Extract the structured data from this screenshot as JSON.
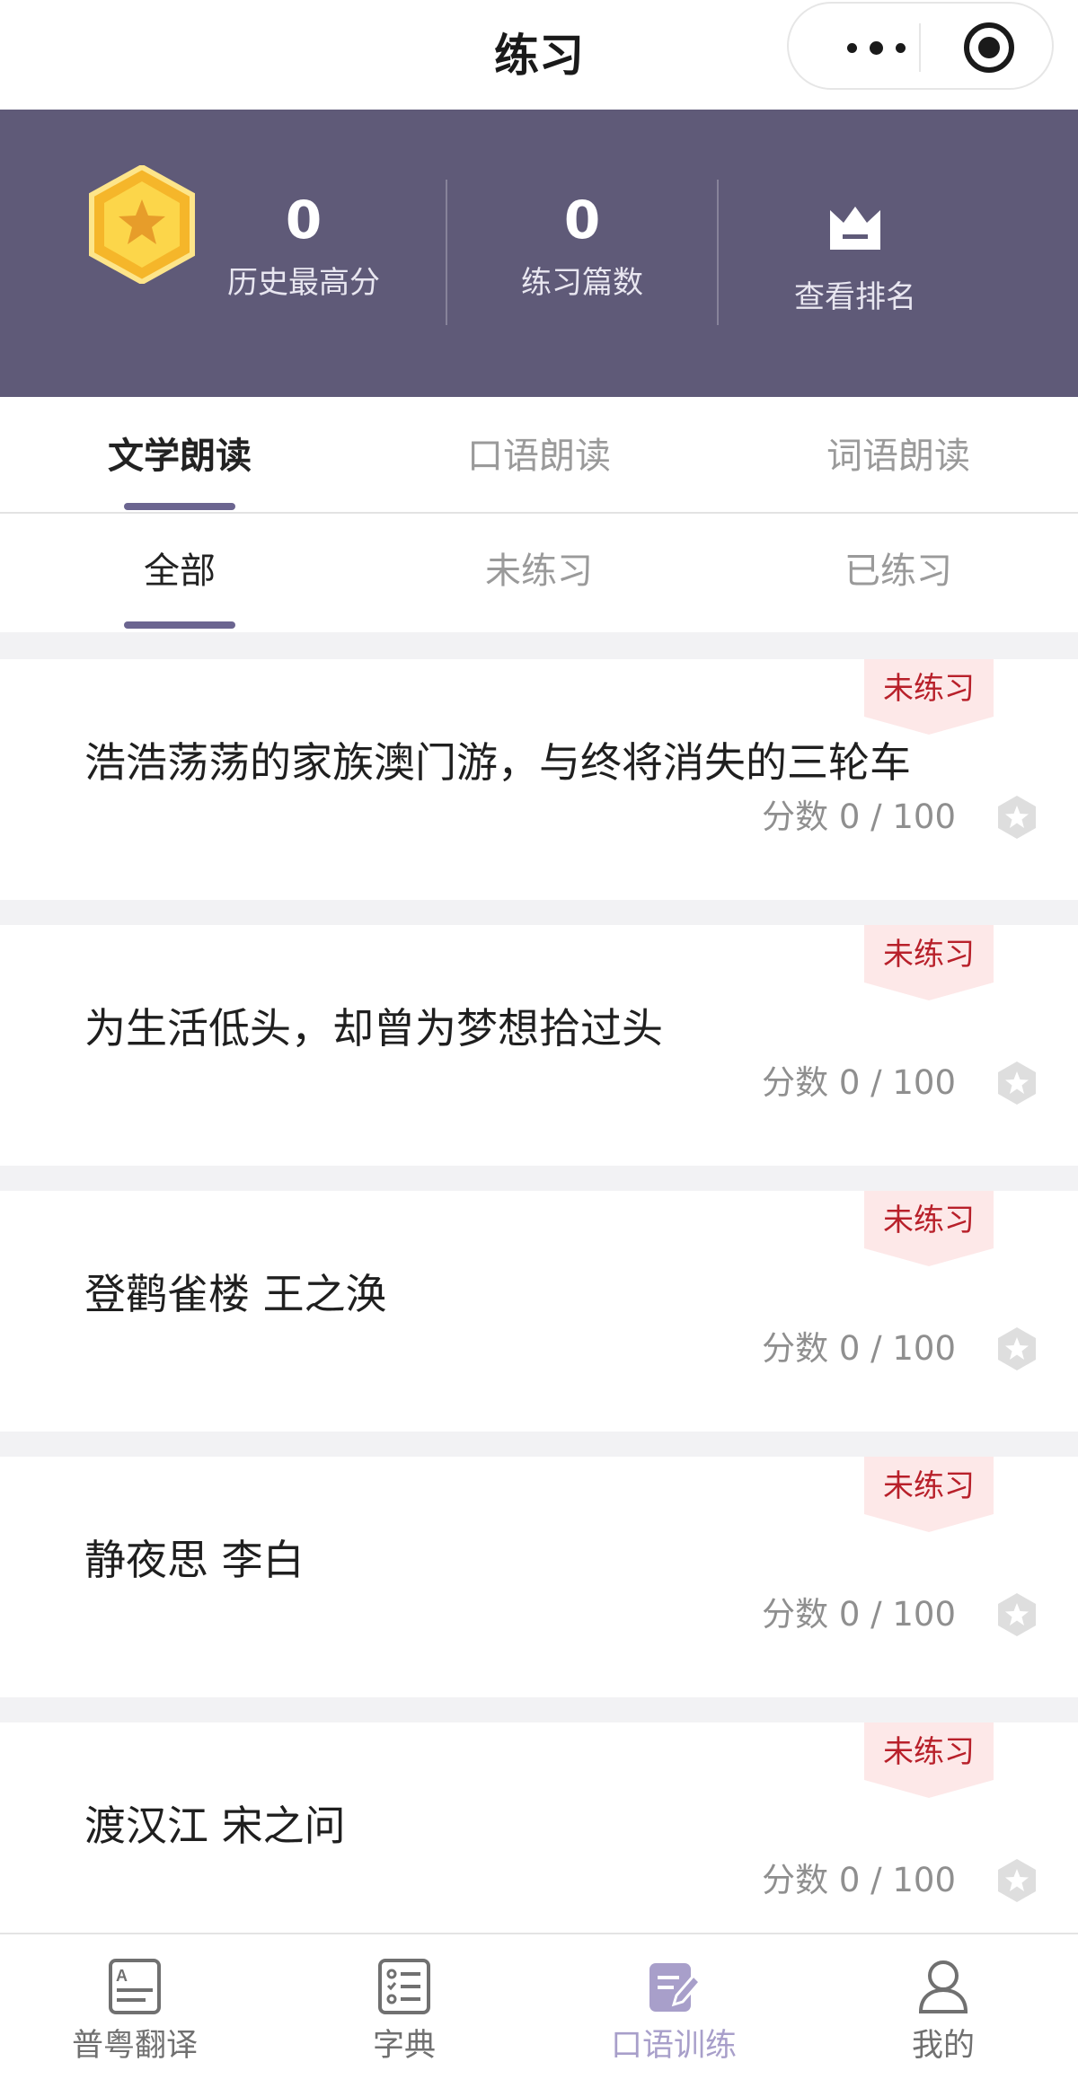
{
  "titlebar": {
    "title": "练习"
  },
  "stats": {
    "best_score": {
      "value": "0",
      "label": "历史最高分"
    },
    "practice_count": {
      "value": "0",
      "label": "练习篇数"
    },
    "ranking": {
      "label": "查看排名"
    }
  },
  "primary_tabs": [
    {
      "label": "文学朗读",
      "active": true
    },
    {
      "label": "口语朗读",
      "active": false
    },
    {
      "label": "词语朗读",
      "active": false
    }
  ],
  "filter_tabs": [
    {
      "label": "全部",
      "active": true
    },
    {
      "label": "未练习",
      "active": false
    },
    {
      "label": "已练习",
      "active": false
    }
  ],
  "items": [
    {
      "title": "浩浩荡荡的家族澳门游，与终将消失的三轮车",
      "status": "未练习",
      "score": "分数 0 / 100"
    },
    {
      "title": "为生活低头，却曾为梦想拾过头",
      "status": "未练习",
      "score": "分数 0 / 100"
    },
    {
      "title": "登鹳雀楼 王之涣",
      "status": "未练习",
      "score": "分数 0 / 100"
    },
    {
      "title": "静夜思 李白",
      "status": "未练习",
      "score": "分数 0 / 100"
    },
    {
      "title": "渡汉江 宋之问",
      "status": "未练习",
      "score": "分数 0 / 100"
    }
  ],
  "bottom_nav": [
    {
      "label": "普粤翻译",
      "icon": "translate-card-icon",
      "active": false
    },
    {
      "label": "字典",
      "icon": "checklist-icon",
      "active": false
    },
    {
      "label": "口语训练",
      "icon": "edit-note-icon",
      "active": true
    },
    {
      "label": "我的",
      "icon": "user-icon",
      "active": false
    }
  ],
  "colors": {
    "banner": "#5f5a78",
    "accent": "#6b6590",
    "badge_text": "#b8202a",
    "badge_bg": "#fde8e8",
    "nav_active": "#a89fca"
  }
}
